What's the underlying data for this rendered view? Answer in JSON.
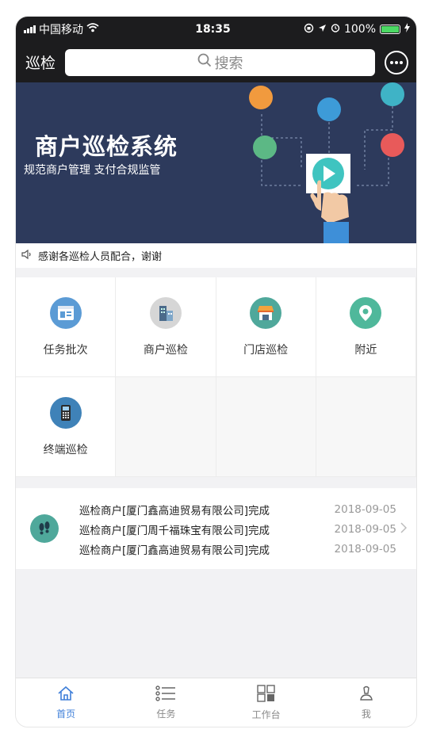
{
  "status": {
    "carrier": "中国移动",
    "time": "18:35",
    "battery": "100%"
  },
  "nav": {
    "title": "巡检",
    "search_placeholder": "搜索"
  },
  "banner": {
    "title": "商户巡检系统",
    "subtitle": "规范商户管理 支付合规监管"
  },
  "notice": {
    "text": "感谢各巡检人员配合，谢谢"
  },
  "grid": [
    {
      "label": "任务批次",
      "icon": "task-batch-icon",
      "color": "#5b9bd5"
    },
    {
      "label": "商户巡检",
      "icon": "merchant-building-icon",
      "color": "#7a8ea0"
    },
    {
      "label": "门店巡检",
      "icon": "store-icon",
      "color": "#4fa89b"
    },
    {
      "label": "附近",
      "icon": "location-pin-icon",
      "color": "#4fb89b"
    },
    {
      "label": "终端巡检",
      "icon": "terminal-icon",
      "color": "#3f82b8"
    }
  ],
  "records": [
    {
      "text": "巡检商户[厦门鑫高迪贸易有限公司]完成",
      "date": "2018-09-05"
    },
    {
      "text": "巡检商户[厦门周千福珠宝有限公司]完成",
      "date": "2018-09-05"
    },
    {
      "text": "巡检商户[厦门鑫高迪贸易有限公司]完成",
      "date": "2018-09-05"
    }
  ],
  "tabs": [
    {
      "label": "首页",
      "icon": "home-icon",
      "active": true
    },
    {
      "label": "任务",
      "icon": "list-icon",
      "active": false
    },
    {
      "label": "工作台",
      "icon": "workbench-icon",
      "active": false
    },
    {
      "label": "我",
      "icon": "profile-icon",
      "active": false
    }
  ],
  "colors": {
    "accent": "#3f7fd9",
    "nav_bg": "#1c1c1e",
    "banner_bg": "#2d3a5c"
  }
}
